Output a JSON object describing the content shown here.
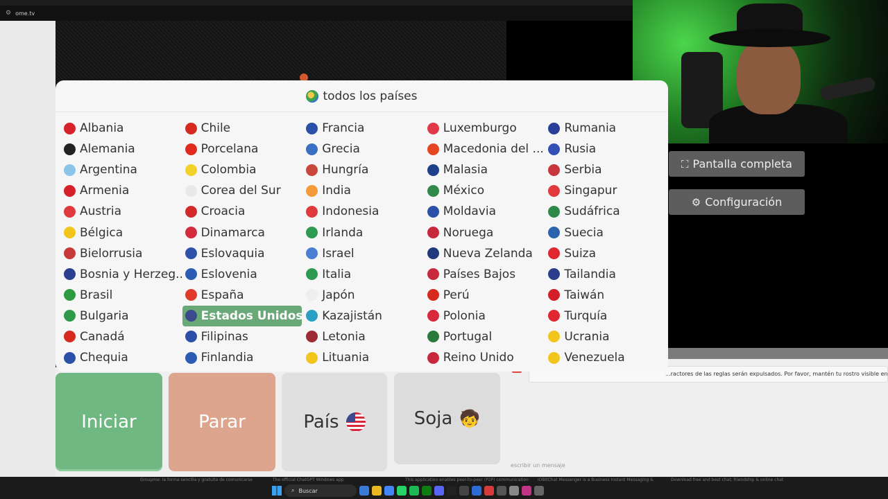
{
  "browser": {
    "url": "ome.tv"
  },
  "dropdown": {
    "title": "todos los países",
    "countries": [
      {
        "name": "Albania",
        "flag": "#d7222a"
      },
      {
        "name": "Chile",
        "flag": "#d52b1e"
      },
      {
        "name": "Francia",
        "flag": "#2b50a8"
      },
      {
        "name": "Luxemburgo",
        "flag": "#e0394a"
      },
      {
        "name": "Rumania",
        "flag": "#2a3f9a"
      },
      {
        "name": "Alemania",
        "flag": "#222222"
      },
      {
        "name": "Porcelana",
        "flag": "#e02a1e"
      },
      {
        "name": "Grecia",
        "flag": "#3b6fc4"
      },
      {
        "name": "Macedonia del ...",
        "flag": "#e64521"
      },
      {
        "name": "Rusia",
        "flag": "#3350b5"
      },
      {
        "name": "Argentina",
        "flag": "#8cc4ea"
      },
      {
        "name": "Colombia",
        "flag": "#f2d12a"
      },
      {
        "name": "Hungría",
        "flag": "#c9463a"
      },
      {
        "name": "Malasia",
        "flag": "#1e3f8a"
      },
      {
        "name": "Serbia",
        "flag": "#c6363c"
      },
      {
        "name": "Armenia",
        "flag": "#d6202c"
      },
      {
        "name": "Corea del Sur",
        "flag": "#e8e8e8"
      },
      {
        "name": "India",
        "flag": "#f29b38"
      },
      {
        "name": "México",
        "flag": "#2f8a4a"
      },
      {
        "name": "Singapur",
        "flag": "#e03a3e"
      },
      {
        "name": "Austria",
        "flag": "#e03a3e"
      },
      {
        "name": "Croacia",
        "flag": "#d22a2a"
      },
      {
        "name": "Indonesia",
        "flag": "#e03a3e"
      },
      {
        "name": "Moldavia",
        "flag": "#2c4fa8"
      },
      {
        "name": "Sudáfrica",
        "flag": "#2d8a4a"
      },
      {
        "name": "Bélgica",
        "flag": "#f2c51c"
      },
      {
        "name": "Dinamarca",
        "flag": "#d52b3e"
      },
      {
        "name": "Irlanda",
        "flag": "#2e9a50"
      },
      {
        "name": "Noruega",
        "flag": "#c8283c"
      },
      {
        "name": "Suecia",
        "flag": "#2c63ad"
      },
      {
        "name": "Bielorrusia",
        "flag": "#c83a3a"
      },
      {
        "name": "Eslovaquia",
        "flag": "#2d52a8"
      },
      {
        "name": "Israel",
        "flag": "#4a7fd4"
      },
      {
        "name": "Nueva Zelanda",
        "flag": "#1f3a7a"
      },
      {
        "name": "Suiza",
        "flag": "#e0262e"
      },
      {
        "name": "Bosnia y Herzeg...",
        "flag": "#2a3f8f"
      },
      {
        "name": "Eslovenia",
        "flag": "#2c5db3"
      },
      {
        "name": "Italia",
        "flag": "#2e9a50"
      },
      {
        "name": "Países Bajos",
        "flag": "#c8283c"
      },
      {
        "name": "Tailandia",
        "flag": "#2b3c8a"
      },
      {
        "name": "Brasil",
        "flag": "#2e9a40"
      },
      {
        "name": "España",
        "flag": "#e03a2a"
      },
      {
        "name": "Japón",
        "flag": "#eeeeee"
      },
      {
        "name": "Perú",
        "flag": "#d52b1e"
      },
      {
        "name": "Taiwán",
        "flag": "#d21f2a"
      },
      {
        "name": "Bulgaria",
        "flag": "#2f9a4a"
      },
      {
        "name": "Estados Unidos",
        "flag": "#3b4a8c",
        "selected": true
      },
      {
        "name": "Kazajistán",
        "flag": "#27a0c4"
      },
      {
        "name": "Polonia",
        "flag": "#d8283c"
      },
      {
        "name": "Turquía",
        "flag": "#e0262e"
      },
      {
        "name": "Canadá",
        "flag": "#d52b1e"
      },
      {
        "name": "Filipinas",
        "flag": "#2c4fa8"
      },
      {
        "name": "Letonia",
        "flag": "#9e2a33"
      },
      {
        "name": "Portugal",
        "flag": "#2b7a3a"
      },
      {
        "name": "Ucrania",
        "flag": "#f2c51c"
      },
      {
        "name": "Chequia",
        "flag": "#2c4fa8"
      },
      {
        "name": "Finlandia",
        "flag": "#2c5db3"
      },
      {
        "name": "Lituania",
        "flag": "#f2c51c"
      },
      {
        "name": "Reino Unido",
        "flag": "#c8283c"
      },
      {
        "name": "Venezuela",
        "flag": "#f2c51c"
      }
    ]
  },
  "side": {
    "fullscreen_label": "Pantalla completa",
    "settings_label": "Configuración"
  },
  "chat": {
    "rule_text": "...ractores de las reglas serán expulsados. Por favor, mantén tu rostro visible en el marco de la",
    "placeholder": "escribir un mensaje"
  },
  "controls": {
    "start_label": "Iniciar",
    "stop_label": "Parar",
    "country_label": "País",
    "gender_label": "Soja",
    "gender_icon": "boy-face-icon"
  },
  "taskbar": {
    "search_label": "Buscar",
    "hints": [
      "Groupme: la forma sencilla y gratuita de comunicarse",
      "The official ChatGPT Windows app",
      "This application enables peer-to-peer (P2P) communication",
      "iOBitChat Messenger is a Business Instant Messaging &",
      "Download free and best chat, friendship & online chat"
    ]
  }
}
